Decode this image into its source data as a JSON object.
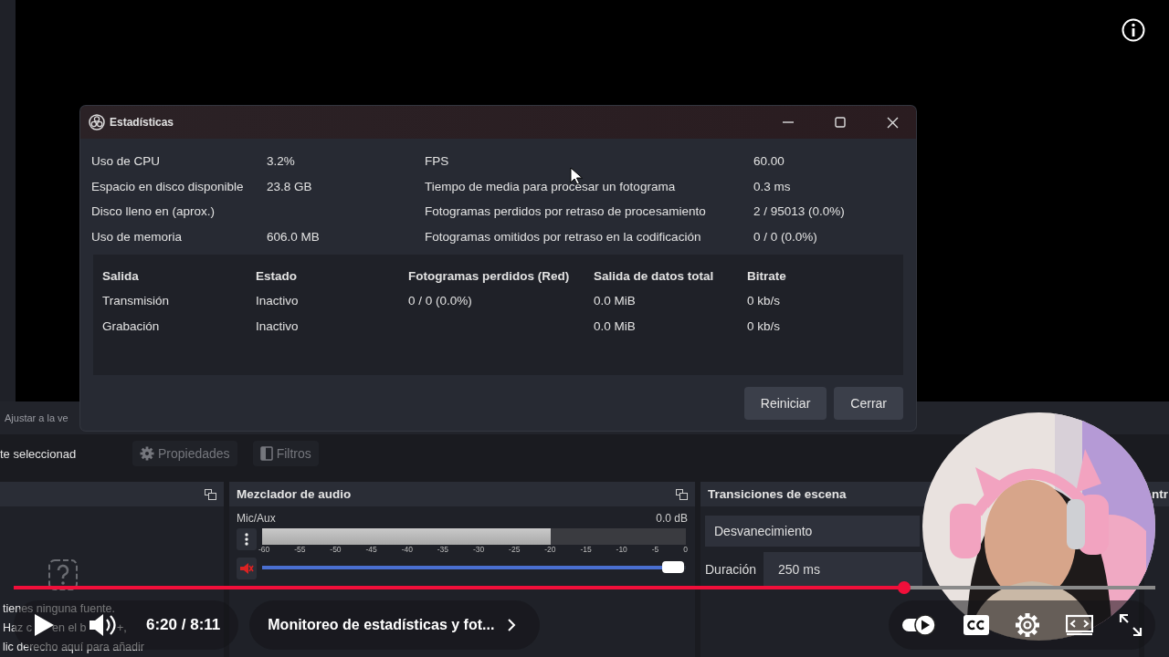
{
  "obs": {
    "preview_status": "Ajustar a la ve",
    "source_toolbar": {
      "label": "te seleccionad",
      "buttons": [
        {
          "kind": "gear",
          "label": "Propiedades",
          "disabled": true
        },
        {
          "kind": "filter",
          "label": "Filtros",
          "disabled": true
        }
      ]
    },
    "sources_dock": {
      "empty_lines": [
        [
          "tienes ninguna fuente."
        ],
        [
          "Haz c",
          "en el b",
          "+,"
        ],
        [
          "lic derecho aquí para añadir"
        ]
      ]
    },
    "audio_mixer": {
      "title": "Mezclador de audio",
      "channel": {
        "name": "Mic/Aux",
        "reading": "0.0 dB",
        "muted": true,
        "meter": {
          "level": 0.68
        },
        "fader": {
          "level": 0.97
        },
        "scale": [
          "-60",
          "-55",
          "-50",
          "-45",
          "-40",
          "-35",
          "-30",
          "-25",
          "-20",
          "-15",
          "-10",
          "-5",
          "0"
        ]
      }
    },
    "scene_transitions": {
      "title": "Transiciones de escena",
      "transition": "Desvanecimiento",
      "duration_label": "Duración",
      "duration": "250 ms"
    },
    "next_dock": {
      "title": "ntr"
    }
  },
  "stats_dialog": {
    "title": "Estadísticas",
    "left_stats": [
      {
        "label": "Uso de CPU",
        "value": "3.2%"
      },
      {
        "label": "Espacio en disco disponible",
        "value": "23.8 GB"
      },
      {
        "label": "Disco lleno en (aprox.)"
      },
      {
        "label": "Uso de memoria",
        "value": "606.0 MB"
      }
    ],
    "right_stats": [
      {
        "label": "FPS",
        "value": "60.00"
      },
      {
        "label": "Tiempo de media para procesar un fotograma",
        "value": "0.3 ms"
      },
      {
        "label": "Fotogramas perdidos por retraso de procesamiento",
        "value": "2 / 95013 (0.0%)"
      },
      {
        "label": "Fotogramas omitidos por retraso en la codificación",
        "value": "0 / 0 (0.0%)"
      }
    ],
    "table": {
      "columns": [
        "Salida",
        "Estado",
        "Fotogramas perdidos (Red)",
        "Salida de datos total",
        "Bitrate"
      ],
      "rows": [
        [
          "Transmisión",
          "Inactivo",
          "0 / 0 (0.0%)",
          "0.0 MiB",
          "0 kb/s"
        ],
        [
          "Grabación",
          "Inactivo",
          null,
          "0.0 MiB",
          "0 kb/s"
        ]
      ]
    },
    "buttons": [
      "Reiniciar",
      "Cerrar"
    ]
  },
  "player": {
    "progress": {
      "level": 0.78
    },
    "paused": true,
    "time": "6:20 / 8:11",
    "chapter": "Monitoreo de estadísticas y fot...",
    "autoplay": {
      "on": true
    }
  }
}
